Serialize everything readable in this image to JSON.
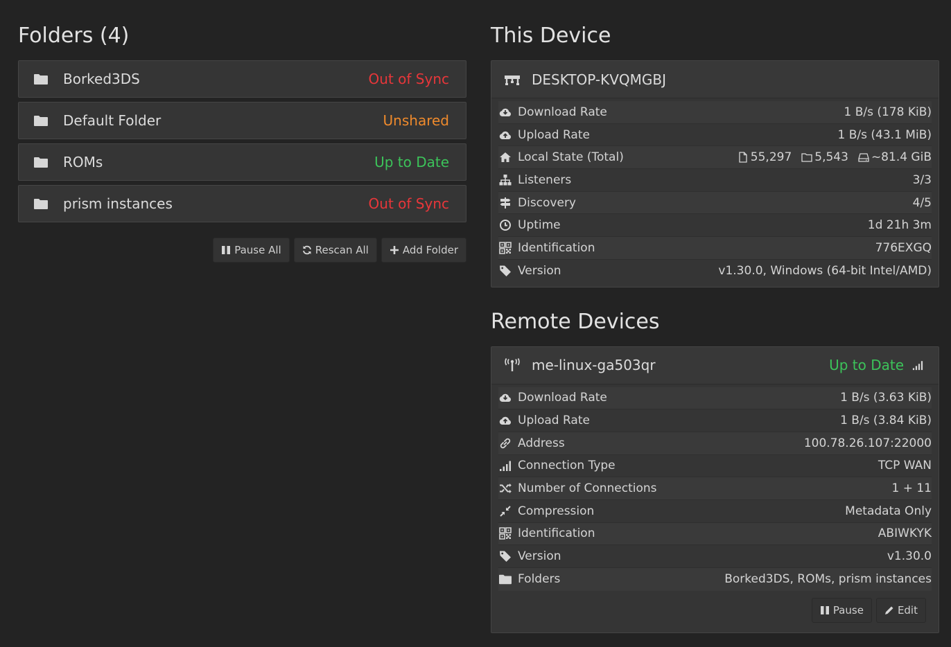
{
  "folders_section": {
    "title": "Folders (4)",
    "folders": [
      {
        "name": "Borked3DS",
        "status": "Out of Sync",
        "status_color": "#e8363a"
      },
      {
        "name": "Default Folder",
        "status": "Unshared",
        "status_color": "#ef8a2c"
      },
      {
        "name": "ROMs",
        "status": "Up to Date",
        "status_color": "#3cc35a"
      },
      {
        "name": "prism instances",
        "status": "Out of Sync",
        "status_color": "#e8363a"
      }
    ],
    "buttons": {
      "pause_all": "Pause All",
      "rescan_all": "Rescan All",
      "add_folder": "Add Folder"
    }
  },
  "this_device": {
    "title": "This Device",
    "name": "DESKTOP-KVQMGBJ",
    "rows": {
      "download_rate": {
        "label": "Download Rate",
        "value": "1 B/s (178 KiB)"
      },
      "upload_rate": {
        "label": "Upload Rate",
        "value": "1 B/s (43.1 MiB)"
      },
      "local_state": {
        "label": "Local State (Total)",
        "files": "55,297",
        "dirs": "5,543",
        "size": "~81.4 GiB"
      },
      "listeners": {
        "label": "Listeners",
        "value": "3/3"
      },
      "discovery": {
        "label": "Discovery",
        "value": "4/5"
      },
      "uptime": {
        "label": "Uptime",
        "value": "1d 21h 3m"
      },
      "identification": {
        "label": "Identification",
        "value": "776EXGQ"
      },
      "version": {
        "label": "Version",
        "value": "v1.30.0, Windows (64-bit Intel/AMD)"
      }
    }
  },
  "remote_devices": {
    "title": "Remote Devices",
    "device": {
      "name": "me-linux-ga503qr",
      "status": "Up to Date",
      "rows": {
        "download_rate": {
          "label": "Download Rate",
          "value": "1 B/s (3.63 KiB)"
        },
        "upload_rate": {
          "label": "Upload Rate",
          "value": "1 B/s (3.84 KiB)"
        },
        "address": {
          "label": "Address",
          "value": "100.78.26.107:22000"
        },
        "connection_type": {
          "label": "Connection Type",
          "value": "TCP WAN"
        },
        "num_connections": {
          "label": "Number of Connections",
          "value": "1 + 11"
        },
        "compression": {
          "label": "Compression",
          "value": "Metadata Only"
        },
        "identification": {
          "label": "Identification",
          "value": "ABIWKYK"
        },
        "version": {
          "label": "Version",
          "value": "v1.30.0"
        },
        "folders": {
          "label": "Folders",
          "value": "Borked3DS, ROMs, prism instances"
        }
      },
      "buttons": {
        "pause": "Pause",
        "edit": "Edit"
      }
    }
  },
  "colors": {
    "green": "#3cc35a",
    "red": "#e8363a",
    "orange": "#ef8a2c",
    "blue": "#3393e6"
  }
}
